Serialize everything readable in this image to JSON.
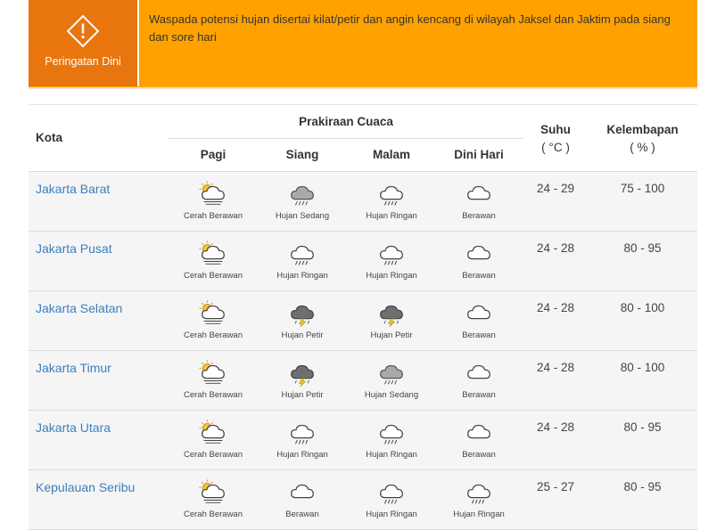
{
  "warning": {
    "label": "Peringatan Dini",
    "text": "Waspada potensi hujan disertai kilat/petir dan angin kencang di wilayah Jaksel dan Jaktim pada siang dan sore hari",
    "icon": "warning-diamond-icon",
    "colors": {
      "banner": "#ffa200",
      "badge": "#e8750e"
    }
  },
  "table": {
    "headers": {
      "kota": "Kota",
      "prakiraan": "Prakiraan Cuaca",
      "slots": [
        "Pagi",
        "Siang",
        "Malam",
        "Dini Hari"
      ],
      "suhu": "Suhu",
      "suhu_unit": "( °C )",
      "kelembapan": "Kelembapan",
      "kelembapan_unit": "( % )"
    },
    "link_color": "#3a7fbf",
    "rows": [
      {
        "city": "Jakarta Barat",
        "weather": [
          {
            "label": "Cerah Berawan",
            "icon": "partly-cloudy-icon"
          },
          {
            "label": "Hujan Sedang",
            "icon": "moderate-rain-icon"
          },
          {
            "label": "Hujan Ringan",
            "icon": "light-rain-icon"
          },
          {
            "label": "Berawan",
            "icon": "cloudy-icon"
          }
        ],
        "temp": "24 - 29",
        "humidity": "75 - 100"
      },
      {
        "city": "Jakarta Pusat",
        "weather": [
          {
            "label": "Cerah Berawan",
            "icon": "partly-cloudy-icon"
          },
          {
            "label": "Hujan Ringan",
            "icon": "light-rain-icon"
          },
          {
            "label": "Hujan Ringan",
            "icon": "light-rain-icon"
          },
          {
            "label": "Berawan",
            "icon": "cloudy-icon"
          }
        ],
        "temp": "24 - 28",
        "humidity": "80 - 95"
      },
      {
        "city": "Jakarta Selatan",
        "weather": [
          {
            "label": "Cerah Berawan",
            "icon": "partly-cloudy-icon"
          },
          {
            "label": "Hujan Petir",
            "icon": "thunderstorm-icon"
          },
          {
            "label": "Hujan Petir",
            "icon": "thunderstorm-icon"
          },
          {
            "label": "Berawan",
            "icon": "cloudy-icon"
          }
        ],
        "temp": "24 - 28",
        "humidity": "80 - 100"
      },
      {
        "city": "Jakarta Timur",
        "weather": [
          {
            "label": "Cerah Berawan",
            "icon": "partly-cloudy-icon"
          },
          {
            "label": "Hujan Petir",
            "icon": "thunderstorm-icon"
          },
          {
            "label": "Hujan Sedang",
            "icon": "moderate-rain-icon"
          },
          {
            "label": "Berawan",
            "icon": "cloudy-icon"
          }
        ],
        "temp": "24 - 28",
        "humidity": "80 - 100"
      },
      {
        "city": "Jakarta Utara",
        "weather": [
          {
            "label": "Cerah Berawan",
            "icon": "partly-cloudy-icon"
          },
          {
            "label": "Hujan Ringan",
            "icon": "light-rain-icon"
          },
          {
            "label": "Hujan Ringan",
            "icon": "light-rain-icon"
          },
          {
            "label": "Berawan",
            "icon": "cloudy-icon"
          }
        ],
        "temp": "24 - 28",
        "humidity": "80 - 95"
      },
      {
        "city": "Kepulauan Seribu",
        "weather": [
          {
            "label": "Cerah Berawan",
            "icon": "partly-cloudy-icon"
          },
          {
            "label": "Berawan",
            "icon": "cloudy-icon"
          },
          {
            "label": "Hujan Ringan",
            "icon": "light-rain-icon"
          },
          {
            "label": "Hujan Ringan",
            "icon": "light-rain-icon"
          }
        ],
        "temp": "25 - 27",
        "humidity": "80 - 95"
      }
    ]
  }
}
